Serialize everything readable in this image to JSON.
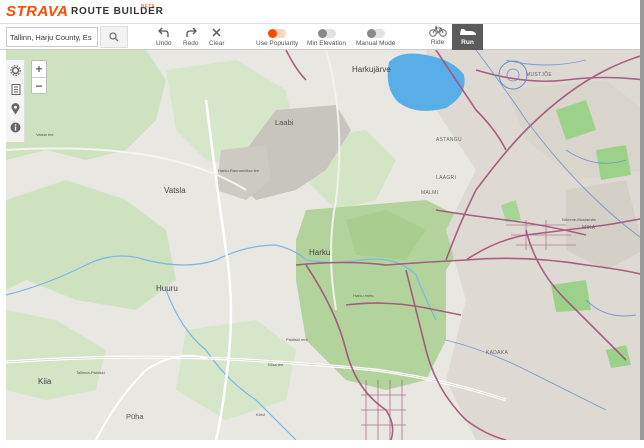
{
  "header": {
    "logo": "STRAVA",
    "title": "ROUTE BUILDER",
    "badge": "BETA"
  },
  "toolbar": {
    "search_value": "Tallinn, Harju County, Es",
    "undo_label": "Undo",
    "redo_label": "Redo",
    "clear_label": "Clear",
    "use_popularity_label": "Use Popularity",
    "use_popularity_on": true,
    "min_elevation_label": "Min Elevation",
    "min_elevation_on": false,
    "manual_mode_label": "Manual Mode",
    "manual_mode_on": false,
    "ride_label": "Ride",
    "run_label": "Run",
    "active_sport": "Run"
  },
  "map_controls": {
    "zoom_in": "+",
    "zoom_out": "−",
    "rail_icons": [
      "gear-icon",
      "document-icon",
      "location-pin-icon",
      "info-icon"
    ]
  },
  "map_labels": {
    "harkujarve": "Harkujärve",
    "laabi": "Laabi",
    "vatsla": "Vatsla",
    "harku": "Harku",
    "huuru": "Huuru",
    "kiia": "Kiia",
    "puha": "Püha",
    "harku_mets": "Harku mets",
    "malmi": "MALMI",
    "laagri": "LAAGRI",
    "astangu": "ASTANGU",
    "mustjoe": "MUSTJÕE",
    "nomme_mustamae": "Nõmme-Mustamäe",
    "mika": "MIKA",
    "kadaka": "KADAKA",
    "vatsla_tee": "Vatsla tee",
    "tallinna_paldiski": "Tallinna-Paldiski",
    "harku_rannamoisa": "Harku-Rannamõisa tee",
    "paldiski_mnt": "Paldiski mnt",
    "rail_tee": "Kiisa tee",
    "korvi": "Kõrvi"
  },
  "colors": {
    "brand": "#fc4c02",
    "route": "#a0527a",
    "water": "#5aaee8",
    "forest": "#b6d6a2",
    "urban": "#d5d2cc"
  }
}
